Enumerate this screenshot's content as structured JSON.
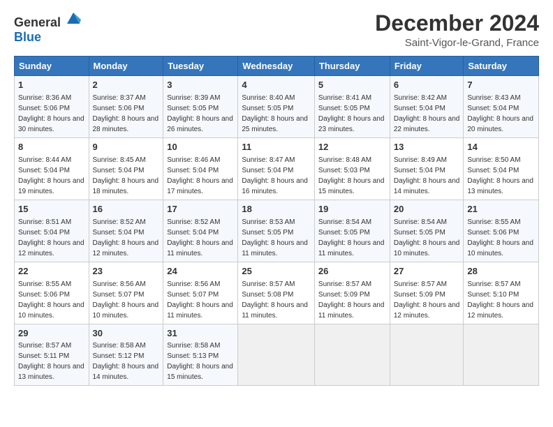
{
  "header": {
    "logo_general": "General",
    "logo_blue": "Blue",
    "month_title": "December 2024",
    "location": "Saint-Vigor-le-Grand, France"
  },
  "days_of_week": [
    "Sunday",
    "Monday",
    "Tuesday",
    "Wednesday",
    "Thursday",
    "Friday",
    "Saturday"
  ],
  "weeks": [
    [
      {
        "day": "1",
        "info": "Sunrise: 8:36 AM\nSunset: 5:06 PM\nDaylight: 8 hours\nand 30 minutes."
      },
      {
        "day": "2",
        "info": "Sunrise: 8:37 AM\nSunset: 5:06 PM\nDaylight: 8 hours\nand 28 minutes."
      },
      {
        "day": "3",
        "info": "Sunrise: 8:39 AM\nSunset: 5:05 PM\nDaylight: 8 hours\nand 26 minutes."
      },
      {
        "day": "4",
        "info": "Sunrise: 8:40 AM\nSunset: 5:05 PM\nDaylight: 8 hours\nand 25 minutes."
      },
      {
        "day": "5",
        "info": "Sunrise: 8:41 AM\nSunset: 5:05 PM\nDaylight: 8 hours\nand 23 minutes."
      },
      {
        "day": "6",
        "info": "Sunrise: 8:42 AM\nSunset: 5:04 PM\nDaylight: 8 hours\nand 22 minutes."
      },
      {
        "day": "7",
        "info": "Sunrise: 8:43 AM\nSunset: 5:04 PM\nDaylight: 8 hours\nand 20 minutes."
      }
    ],
    [
      {
        "day": "8",
        "info": "Sunrise: 8:44 AM\nSunset: 5:04 PM\nDaylight: 8 hours\nand 19 minutes."
      },
      {
        "day": "9",
        "info": "Sunrise: 8:45 AM\nSunset: 5:04 PM\nDaylight: 8 hours\nand 18 minutes."
      },
      {
        "day": "10",
        "info": "Sunrise: 8:46 AM\nSunset: 5:04 PM\nDaylight: 8 hours\nand 17 minutes."
      },
      {
        "day": "11",
        "info": "Sunrise: 8:47 AM\nSunset: 5:04 PM\nDaylight: 8 hours\nand 16 minutes."
      },
      {
        "day": "12",
        "info": "Sunrise: 8:48 AM\nSunset: 5:03 PM\nDaylight: 8 hours\nand 15 minutes."
      },
      {
        "day": "13",
        "info": "Sunrise: 8:49 AM\nSunset: 5:04 PM\nDaylight: 8 hours\nand 14 minutes."
      },
      {
        "day": "14",
        "info": "Sunrise: 8:50 AM\nSunset: 5:04 PM\nDaylight: 8 hours\nand 13 minutes."
      }
    ],
    [
      {
        "day": "15",
        "info": "Sunrise: 8:51 AM\nSunset: 5:04 PM\nDaylight: 8 hours\nand 12 minutes."
      },
      {
        "day": "16",
        "info": "Sunrise: 8:52 AM\nSunset: 5:04 PM\nDaylight: 8 hours\nand 12 minutes."
      },
      {
        "day": "17",
        "info": "Sunrise: 8:52 AM\nSunset: 5:04 PM\nDaylight: 8 hours\nand 11 minutes."
      },
      {
        "day": "18",
        "info": "Sunrise: 8:53 AM\nSunset: 5:05 PM\nDaylight: 8 hours\nand 11 minutes."
      },
      {
        "day": "19",
        "info": "Sunrise: 8:54 AM\nSunset: 5:05 PM\nDaylight: 8 hours\nand 11 minutes."
      },
      {
        "day": "20",
        "info": "Sunrise: 8:54 AM\nSunset: 5:05 PM\nDaylight: 8 hours\nand 10 minutes."
      },
      {
        "day": "21",
        "info": "Sunrise: 8:55 AM\nSunset: 5:06 PM\nDaylight: 8 hours\nand 10 minutes."
      }
    ],
    [
      {
        "day": "22",
        "info": "Sunrise: 8:55 AM\nSunset: 5:06 PM\nDaylight: 8 hours\nand 10 minutes."
      },
      {
        "day": "23",
        "info": "Sunrise: 8:56 AM\nSunset: 5:07 PM\nDaylight: 8 hours\nand 10 minutes."
      },
      {
        "day": "24",
        "info": "Sunrise: 8:56 AM\nSunset: 5:07 PM\nDaylight: 8 hours\nand 11 minutes."
      },
      {
        "day": "25",
        "info": "Sunrise: 8:57 AM\nSunset: 5:08 PM\nDaylight: 8 hours\nand 11 minutes."
      },
      {
        "day": "26",
        "info": "Sunrise: 8:57 AM\nSunset: 5:09 PM\nDaylight: 8 hours\nand 11 minutes."
      },
      {
        "day": "27",
        "info": "Sunrise: 8:57 AM\nSunset: 5:09 PM\nDaylight: 8 hours\nand 12 minutes."
      },
      {
        "day": "28",
        "info": "Sunrise: 8:57 AM\nSunset: 5:10 PM\nDaylight: 8 hours\nand 12 minutes."
      }
    ],
    [
      {
        "day": "29",
        "info": "Sunrise: 8:57 AM\nSunset: 5:11 PM\nDaylight: 8 hours\nand 13 minutes."
      },
      {
        "day": "30",
        "info": "Sunrise: 8:58 AM\nSunset: 5:12 PM\nDaylight: 8 hours\nand 14 minutes."
      },
      {
        "day": "31",
        "info": "Sunrise: 8:58 AM\nSunset: 5:13 PM\nDaylight: 8 hours\nand 15 minutes."
      },
      {
        "day": "",
        "info": ""
      },
      {
        "day": "",
        "info": ""
      },
      {
        "day": "",
        "info": ""
      },
      {
        "day": "",
        "info": ""
      }
    ]
  ]
}
